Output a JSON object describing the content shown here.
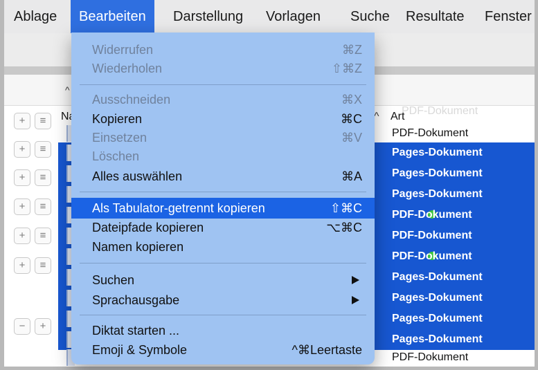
{
  "menubar": {
    "items": [
      "Ablage",
      "Bearbeiten",
      "Darstellung",
      "Vorlagen",
      "Suche",
      "Resultate",
      "Fenster"
    ]
  },
  "table": {
    "name_header": "Na",
    "art_header": "Art",
    "ghost_text": "PDF-Dokument",
    "rows": [
      {
        "art": "PDF-Dokument",
        "selected": false
      },
      {
        "art": "Pages-Dokument",
        "selected": true
      },
      {
        "art": "Pages-Dokument",
        "selected": true
      },
      {
        "art": "Pages-Dokument",
        "selected": true
      },
      {
        "art": "PDF-Dokument",
        "selected": true
      },
      {
        "art": "PDF-Dokument",
        "selected": true
      },
      {
        "art": "PDF-Dokument",
        "selected": true
      },
      {
        "art": "Pages-Dokument",
        "selected": true
      },
      {
        "art": "Pages-Dokument",
        "selected": true
      },
      {
        "art": "Pages-Dokument",
        "selected": true
      },
      {
        "art": "Pages-Dokument",
        "selected": true
      },
      {
        "art": "PDF-Dokument",
        "selected": false
      }
    ]
  },
  "buttons": {
    "plus": "+",
    "rule": "≡",
    "minus": "−"
  },
  "menu": {
    "items": [
      {
        "label": "Widerrufen",
        "shortcut": "⌘Z",
        "disabled": true
      },
      {
        "label": "Wiederholen",
        "shortcut": "⇧⌘Z",
        "disabled": true
      },
      {
        "label": "Ausschneiden",
        "shortcut": "⌘X",
        "disabled": true
      },
      {
        "label": "Kopieren",
        "shortcut": "⌘C",
        "disabled": false
      },
      {
        "label": "Einsetzen",
        "shortcut": "⌘V",
        "disabled": true
      },
      {
        "label": "Löschen",
        "shortcut": "",
        "disabled": true
      },
      {
        "label": "Alles auswählen",
        "shortcut": "⌘A",
        "disabled": false
      },
      {
        "label": "Als Tabulator-getrennt kopieren",
        "shortcut": "⇧⌘C",
        "disabled": false,
        "highlighted": true
      },
      {
        "label": "Dateipfade kopieren",
        "shortcut": "⌥⌘C",
        "disabled": false
      },
      {
        "label": "Namen kopieren",
        "shortcut": "",
        "disabled": false
      },
      {
        "label": "Suchen",
        "shortcut": "",
        "disabled": false,
        "submenu": true
      },
      {
        "label": "Sprachausgabe",
        "shortcut": "",
        "disabled": false,
        "submenu": true
      },
      {
        "label": "Diktat starten ...",
        "shortcut": "",
        "disabled": false
      },
      {
        "label": "Emoji & Symbole",
        "shortcut": "^⌘Leertaste",
        "disabled": false
      }
    ]
  },
  "colors": {
    "menu_bg": "#9fc3f2",
    "highlight": "#1b63e4",
    "selection": "#1757d1",
    "status_dot": "#39c43c"
  }
}
